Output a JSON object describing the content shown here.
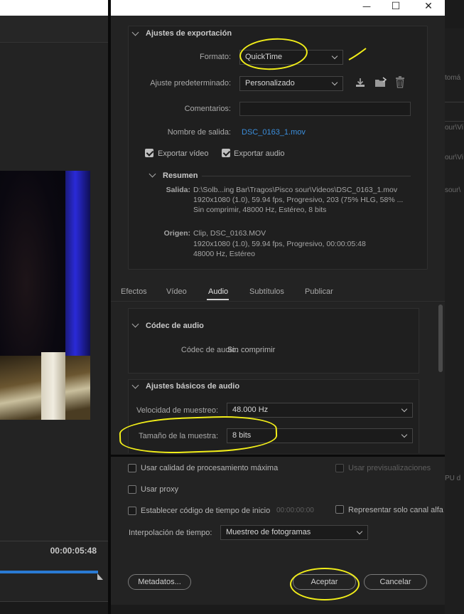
{
  "window": {
    "minimize": "—",
    "maximize": "☐",
    "close": "✕"
  },
  "export_settings": {
    "title": "Ajustes de exportación",
    "format_label": "Formato:",
    "format_value": "QuickTime",
    "preset_label": "Ajuste predeterminado:",
    "preset_value": "Personalizado",
    "comments_label": "Comentarios:",
    "comments_value": "",
    "output_name_label": "Nombre de salida:",
    "output_name_value": "DSC_0163_1.mov",
    "export_video_label": "Exportar vídeo",
    "export_video_checked": true,
    "export_audio_label": "Exportar audio",
    "export_audio_checked": true
  },
  "summary": {
    "title": "Resumen",
    "output_key": "Salida:",
    "output_lines": [
      "D:\\Solb...ing Bar\\Tragos\\Pisco sour\\Videos\\DSC_0163_1.mov",
      "1920x1080 (1.0), 59.94 fps, Progresivo, 203 (75% HLG, 58% ...",
      "Sin comprimir, 48000 Hz, Estéreo, 8 bits"
    ],
    "source_key": "Origen:",
    "source_lines": [
      "Clip, DSC_0163.MOV",
      "1920x1080 (1.0), 59.94 fps, Progresivo, 00:00:05:48",
      "48000 Hz, Estéreo"
    ]
  },
  "tabs": [
    "Efectos",
    "Vídeo",
    "Audio",
    "Subtítulos",
    "Publicar"
  ],
  "active_tab": "Audio",
  "audio_codec": {
    "title": "Códec de audio",
    "codec_label": "Códec de audio:",
    "codec_value": "Sin comprimir"
  },
  "basic_audio": {
    "title": "Ajustes básicos de audio",
    "sample_rate_label": "Velocidad de muestreo:",
    "sample_rate_value": "48.000 Hz",
    "sample_size_label": "Tamaño de la muestra:",
    "sample_size_value": "8 bits"
  },
  "bottom_options": {
    "max_quality": "Usar calidad de procesamiento máxima",
    "use_previews": "Usar previsualizaciones",
    "use_proxy": "Usar proxy",
    "set_timecode": "Establecer código de tiempo de inicio",
    "timecode_value": "00:00:00:00",
    "alpha_only": "Representar solo canal alfa",
    "time_interp_label": "Interpolación de tiempo:",
    "time_interp_value": "Muestreo de fotogramas"
  },
  "buttons": {
    "metadata": "Metadatos...",
    "accept": "Aceptar",
    "cancel": "Cancelar"
  },
  "preview": {
    "timecode": "00:00:05:48"
  },
  "background_window": {
    "texts": [
      "tomá",
      "our\\Vi",
      "our\\Vi",
      "sour\\",
      "PU d"
    ]
  },
  "colors": {
    "accent_link": "#3b8edc",
    "annotation": "#f2ee19",
    "progress": "#2a7ad4"
  }
}
